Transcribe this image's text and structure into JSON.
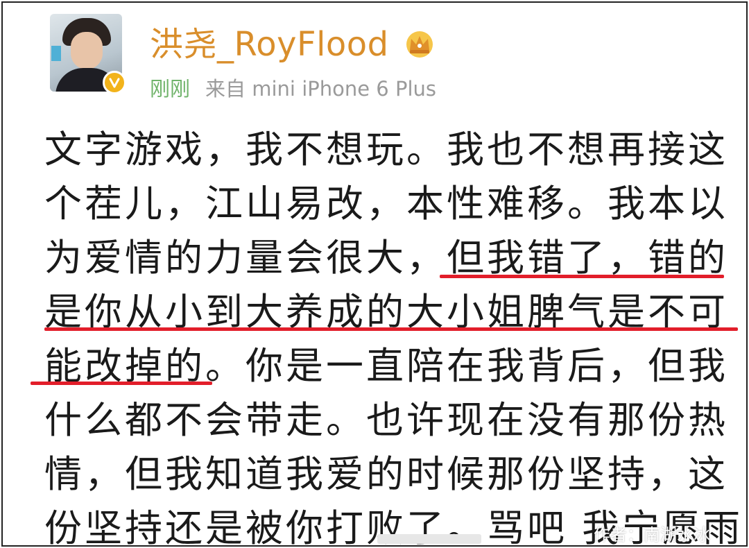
{
  "post": {
    "author": "洪尧_RoyFlood",
    "time": "刚刚",
    "source": "来自 mini iPhone 6 Plus",
    "lines": [
      "文字游戏，我不想玩。我也不想再接这",
      "个茬儿，江山易改，本性难移。我本以",
      "为爱情的力量会很大，但我错了，错的",
      "是你从小到大养成的大小姐脾气是不可",
      "能改掉的。你是一直陪在我背后，但我",
      "什么都不会带走。也许现在没有那份热",
      "情，但我知道我爱的时候那份坚持，这",
      "份坚持还是被你打败了。骂吧 我宁愿雨"
    ]
  },
  "watermark": "作者：南湖水冰",
  "icons": {
    "verified": "verified-v-icon",
    "membership": "crown-icon"
  },
  "colors": {
    "username": "#d98e2b",
    "time": "#6fb36a",
    "underline": "#e21e2a",
    "verified_badge": "#f2b31b"
  }
}
